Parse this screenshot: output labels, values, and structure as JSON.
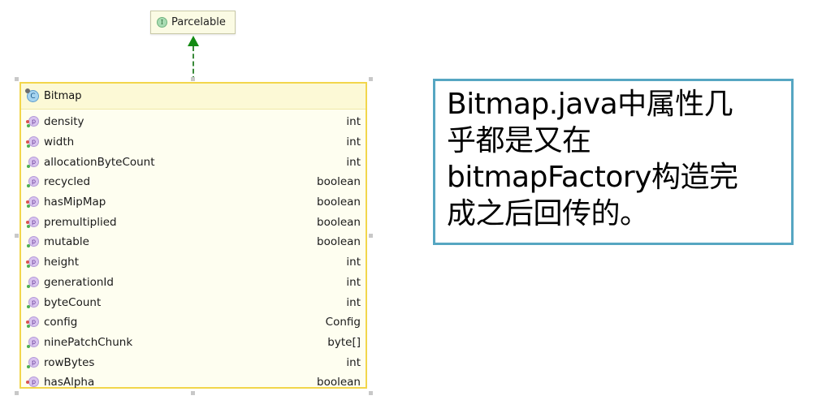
{
  "interface_node": {
    "icon": "interface-icon",
    "icon_letter": "I",
    "name": "Parcelable"
  },
  "relationship": {
    "type": "implements",
    "style": "dashed-arrow",
    "color": "#138a13"
  },
  "class_node": {
    "icon": "class-icon",
    "icon_letter": "C",
    "name": "Bitmap",
    "fields": [
      {
        "name": "density",
        "type": "int",
        "icon_letter": "p",
        "red_dot": true,
        "green_dot": true
      },
      {
        "name": "width",
        "type": "int",
        "icon_letter": "p",
        "red_dot": true,
        "green_dot": true
      },
      {
        "name": "allocationByteCount",
        "type": "int",
        "icon_letter": "p",
        "red_dot": false,
        "green_dot": true
      },
      {
        "name": "recycled",
        "type": "boolean",
        "icon_letter": "p",
        "red_dot": false,
        "green_dot": true
      },
      {
        "name": "hasMipMap",
        "type": "boolean",
        "icon_letter": "p",
        "red_dot": true,
        "green_dot": true
      },
      {
        "name": "premultiplied",
        "type": "boolean",
        "icon_letter": "p",
        "red_dot": true,
        "green_dot": true
      },
      {
        "name": "mutable",
        "type": "boolean",
        "icon_letter": "p",
        "red_dot": false,
        "green_dot": true
      },
      {
        "name": "height",
        "type": "int",
        "icon_letter": "p",
        "red_dot": true,
        "green_dot": true
      },
      {
        "name": "generationId",
        "type": "int",
        "icon_letter": "p",
        "red_dot": false,
        "green_dot": true
      },
      {
        "name": "byteCount",
        "type": "int",
        "icon_letter": "p",
        "red_dot": false,
        "green_dot": true
      },
      {
        "name": "config",
        "type": "Config",
        "icon_letter": "p",
        "red_dot": true,
        "green_dot": true
      },
      {
        "name": "ninePatchChunk",
        "type": "byte[]",
        "icon_letter": "p",
        "red_dot": false,
        "green_dot": true
      },
      {
        "name": "rowBytes",
        "type": "int",
        "icon_letter": "p",
        "red_dot": false,
        "green_dot": true
      },
      {
        "name": "hasAlpha",
        "type": "boolean",
        "icon_letter": "p",
        "red_dot": true,
        "green_dot": false
      }
    ]
  },
  "note": {
    "lines": [
      "Bitmap.java中属性几",
      "乎都是又在",
      "bitmapFactory构造完",
      "成之后回传的。"
    ],
    "border_color": "#56a6c2"
  }
}
